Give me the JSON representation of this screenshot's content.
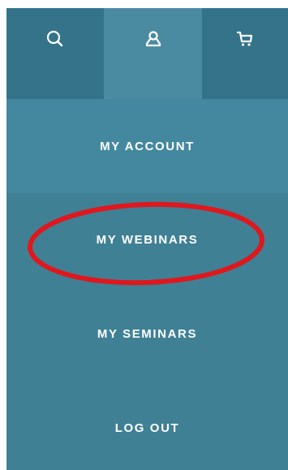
{
  "topbar": {
    "items": [
      {
        "icon": "search-icon"
      },
      {
        "icon": "user-icon"
      },
      {
        "icon": "cart-icon"
      }
    ]
  },
  "menu": {
    "items": [
      {
        "label": "MY ACCOUNT"
      },
      {
        "label": "MY WEBINARS"
      },
      {
        "label": "MY SEMINARS"
      },
      {
        "label": "LOG OUT"
      }
    ]
  },
  "colors": {
    "panel": "#3f8095",
    "topbar_dark": "#34738a",
    "topbar_active": "#4b8ba1",
    "account_row": "#4488a0",
    "text": "#ffffff",
    "annotation": "#e0171c"
  }
}
